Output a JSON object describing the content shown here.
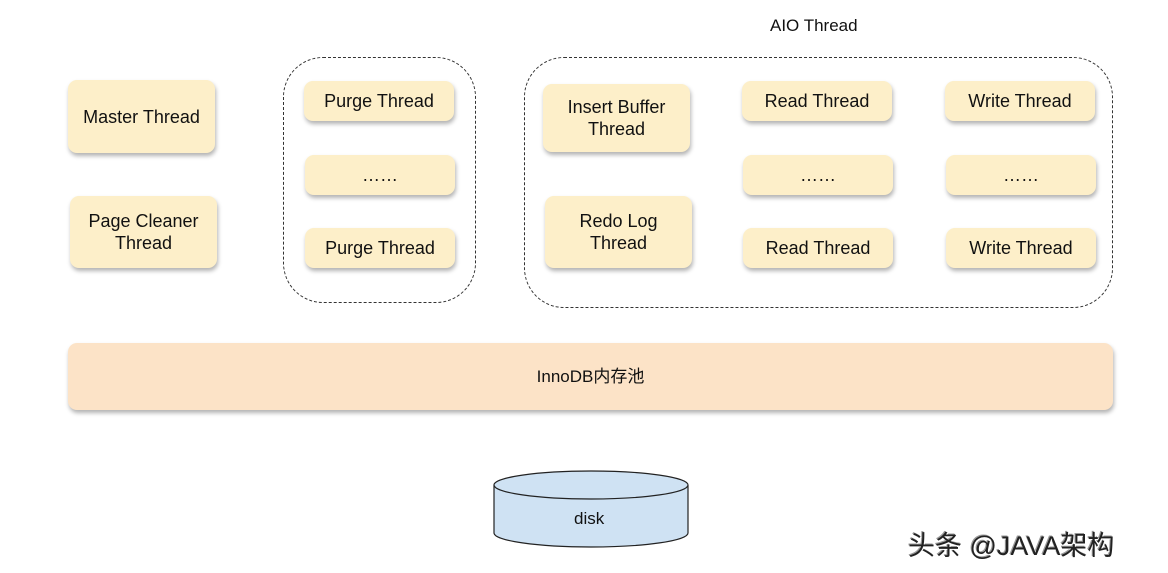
{
  "aio_group": {
    "label": "AIO Thread"
  },
  "master_thread": "Master Thread",
  "page_cleaner_thread": "Page Cleaner Thread",
  "purge_group": {
    "items": [
      "Purge Thread",
      "……",
      "Purge Thread"
    ]
  },
  "insert_buffer_thread": "Insert Buffer Thread",
  "redo_log_thread": "Redo Log Thread",
  "read_threads": [
    "Read Thread",
    "……",
    "Read Thread"
  ],
  "write_threads": [
    "Write Thread",
    "……",
    "Write Thread"
  ],
  "buffer_pool": "InnoDB内存池",
  "disk": "disk",
  "watermark": "头条 @JAVA架构",
  "colors": {
    "thread_box": "#fdefc9",
    "buffer_pool": "#fce3c7",
    "disk": "#cfe2f3"
  }
}
